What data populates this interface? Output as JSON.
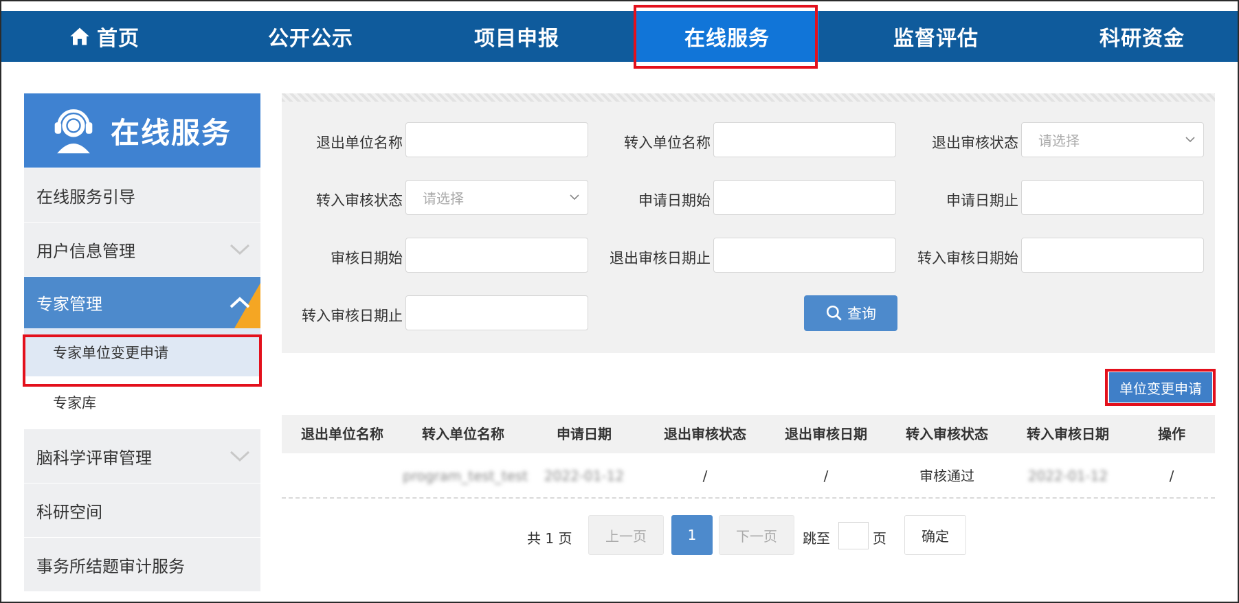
{
  "nav": {
    "items": [
      {
        "label": "首页"
      },
      {
        "label": "公开公示"
      },
      {
        "label": "项目申报"
      },
      {
        "label": "在线服务"
      },
      {
        "label": "监督评估"
      },
      {
        "label": "科研资金"
      }
    ]
  },
  "sidebar": {
    "banner_title": "在线服务",
    "items": [
      {
        "label": "在线服务引导"
      },
      {
        "label": "用户信息管理"
      },
      {
        "label": "专家管理"
      },
      {
        "label": "专家单位变更申请"
      },
      {
        "label": "专家库"
      },
      {
        "label": "脑科学评审管理"
      },
      {
        "label": "科研空间"
      },
      {
        "label": "事务所结题审计服务"
      }
    ]
  },
  "filters": {
    "exit_unit_name": {
      "label": "退出单位名称",
      "value": ""
    },
    "transfer_unit_name": {
      "label": "转入单位名称",
      "value": ""
    },
    "exit_review_status": {
      "label": "退出审核状态",
      "placeholder": "请选择"
    },
    "transfer_review_status": {
      "label": "转入审核状态",
      "placeholder": "请选择"
    },
    "apply_date_start": {
      "label": "申请日期始",
      "value": ""
    },
    "apply_date_end": {
      "label": "申请日期止",
      "value": ""
    },
    "review_date_start": {
      "label": "审核日期始",
      "value": ""
    },
    "exit_review_date_end": {
      "label": "退出审核日期止",
      "value": ""
    },
    "transfer_review_date_start": {
      "label": "转入审核日期始",
      "value": ""
    },
    "transfer_review_date_end": {
      "label": "转入审核日期止",
      "value": ""
    },
    "query_label": "查询"
  },
  "apply_button": "单位变更申请",
  "table": {
    "columns": [
      "退出单位名称",
      "转入单位名称",
      "申请日期",
      "退出审核状态",
      "退出审核日期",
      "转入审核状态",
      "转入审核日期",
      "操作"
    ],
    "rows": [
      [
        "",
        "program_test_test",
        "2022-01-12",
        "/",
        "/",
        "审核通过",
        "2022-01-12",
        "/"
      ]
    ]
  },
  "pagination": {
    "total_text": "共 1 页",
    "prev": "上一页",
    "current": "1",
    "next": "下一页",
    "jump_to": "跳至",
    "page_unit": "页",
    "confirm": "确定"
  },
  "colors": {
    "nav_bg": "#0f5b9c",
    "nav_active": "#1175d8",
    "accent": "#4d8acc",
    "highlight": "#e3101c",
    "corner": "#f5a623"
  }
}
